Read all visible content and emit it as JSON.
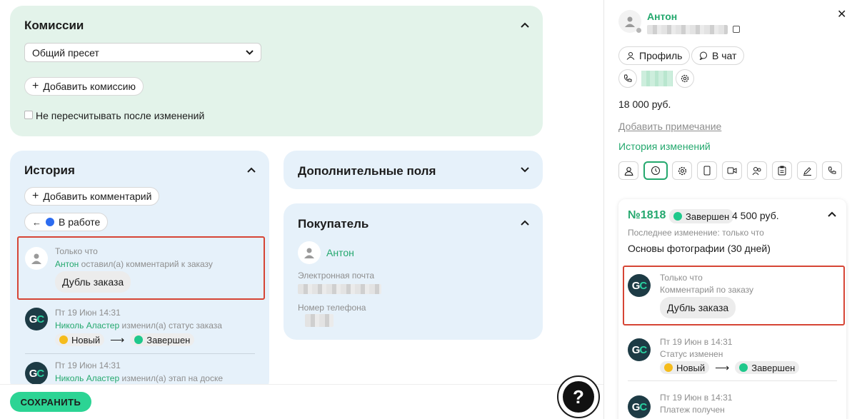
{
  "commissions": {
    "title": "Комиссии",
    "preset_value": "Общий пресет",
    "add_button": "Добавить комиссию",
    "checkbox_label": "Не пересчитывать после изменений"
  },
  "history": {
    "title": "История",
    "add_comment_button": "Добавить комментарий",
    "status_button": "В работе",
    "entries": [
      {
        "time": "Только что",
        "author": "Антон",
        "action": "оставил(а) комментарий к заказу",
        "comment": "Дубль заказа"
      },
      {
        "time": "Пт 19 Июн 14:31",
        "author": "Николь Аластер",
        "action": "изменил(а) статус заказа",
        "from": "Новый",
        "to": "Завершен"
      },
      {
        "time": "Пт 19 Июн 14:31",
        "author": "Николь Аластер",
        "action": "изменил(а) этап на доске"
      }
    ]
  },
  "extra_fields": {
    "title": "Дополнительные поля"
  },
  "buyer": {
    "title": "Покупатель",
    "name": "Антон",
    "email_label": "Электронная почта",
    "phone_label": "Номер телефона"
  },
  "save_button": "СОХРАНИТЬ",
  "help_button": "?",
  "right_panel": {
    "user_name": "Антон",
    "profile_button": "Профиль",
    "chat_button": "В чат",
    "amount": "18 000 руб.",
    "add_note_link": "Добавить примечание",
    "history_link": "История изменений",
    "order": {
      "number": "№1818",
      "status": "Завершен",
      "price": "4 500 руб.",
      "last_change": "Последнее изменение: только что",
      "product": "Основы фотографии (30 дней)"
    },
    "events": [
      {
        "time": "Только что",
        "text": "Комментарий по заказу",
        "comment": "Дубль заказа"
      },
      {
        "time": "Пт 19 Июн в 14:31",
        "text": "Статус изменен",
        "from": "Новый",
        "to": "Завершен"
      },
      {
        "time": "Пт 19 Июн в 14:31",
        "text": "Платеж получен"
      }
    ]
  },
  "colors": {
    "green": "#24a86e",
    "status_new": "#f5bc1c",
    "status_done": "#1fc88b",
    "status_in_work": "#2d6cf0",
    "highlight": "#d64535"
  }
}
